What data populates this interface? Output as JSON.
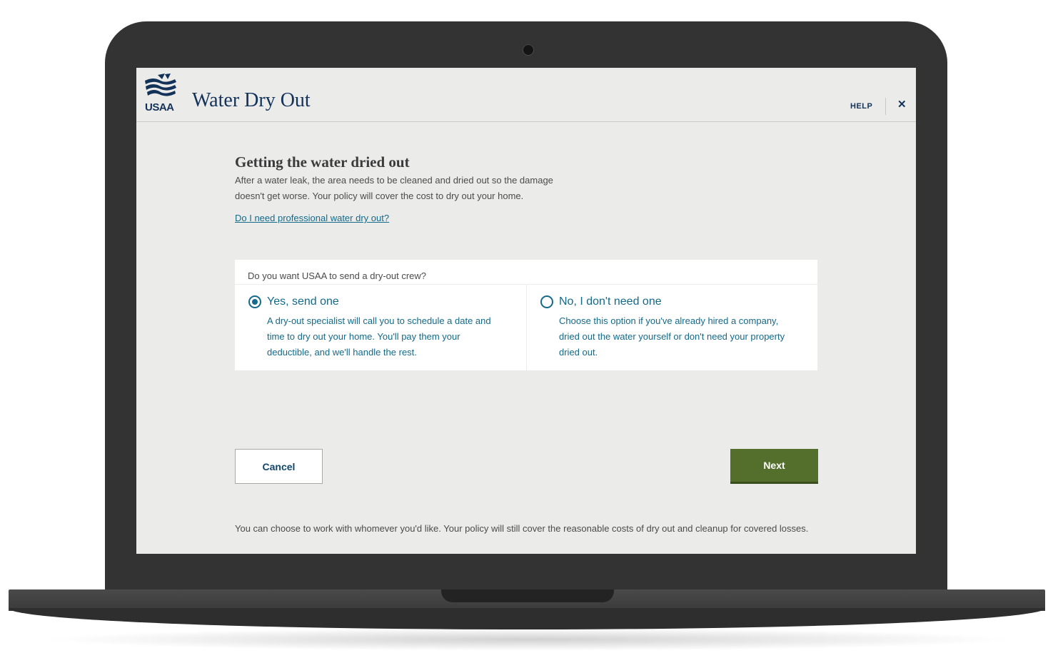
{
  "app": {
    "logo_text": "USAA",
    "title": "Water Dry Out",
    "help_label": "HELP",
    "close_symbol": "✕"
  },
  "page": {
    "title": "Getting the water dried out",
    "intro": "After a water leak, the area needs to be cleaned and dried out so the damage doesn't get worse. Your policy will cover the cost to dry out your home.",
    "help_link": "Do I need professional water dry out?"
  },
  "question": {
    "label": "Do you want USAA to send a dry-out crew?",
    "selected": "yes",
    "options": [
      {
        "id": "yes",
        "title": "Yes, send one",
        "description": "A dry-out specialist will call you to schedule a date and time to dry out your home. You'll pay them your deductible, and we'll handle the rest."
      },
      {
        "id": "no",
        "title": "No, I don't need one",
        "description": "Choose this option if you've already hired a company, dried out the water yourself or don't need your property dried out."
      }
    ]
  },
  "actions": {
    "cancel_label": "Cancel",
    "next_label": "Next"
  },
  "footnote": "You can choose to work with whomever you'd like. Your policy will still cover the reasonable costs of dry out and cleanup for covered losses.",
  "colors": {
    "brand_navy": "#12325a",
    "link_teal": "#136a8a",
    "next_green": "#546f2c",
    "screen_bg": "#ebebe9",
    "laptop_frame": "#333333"
  },
  "icons": [
    "usaa-eagle-logo-icon",
    "close-icon",
    "radio-checked-icon",
    "radio-unchecked-icon",
    "webcam-icon"
  ]
}
